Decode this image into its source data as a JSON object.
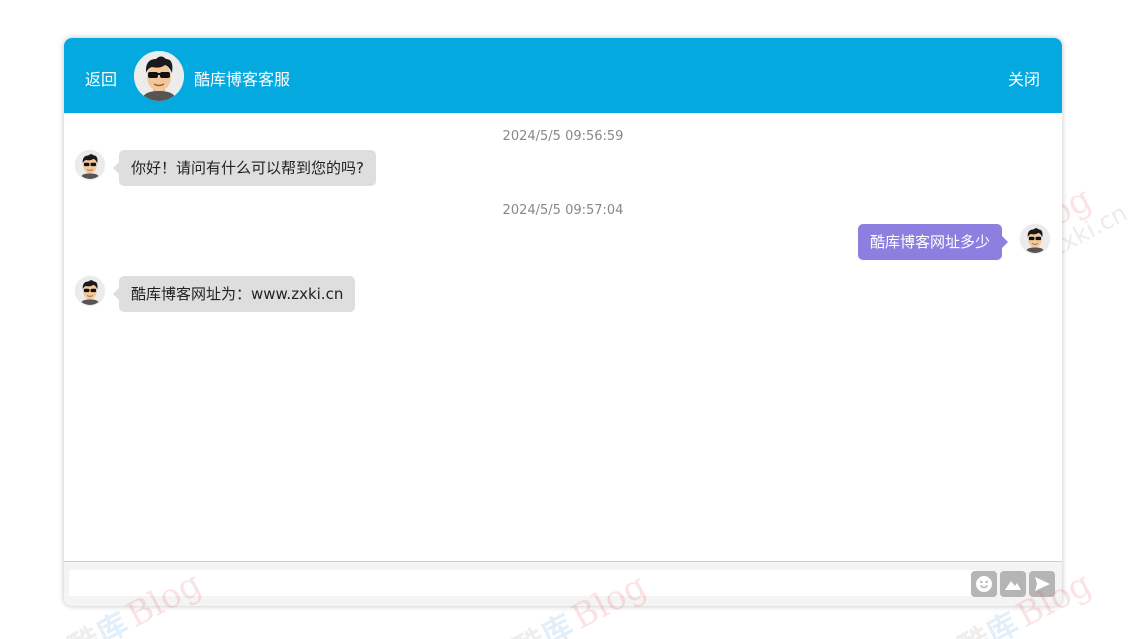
{
  "header": {
    "back_label": "返回",
    "title": "酷库博客客服",
    "close_label": "关闭",
    "background_color": "#03a9df"
  },
  "messages": [
    {
      "time": "2024/5/5 09:56:59",
      "direction": "incoming",
      "text": "你好！请问有什么可以帮到您的吗?"
    },
    {
      "time": "2024/5/5 09:57:04",
      "direction": "outgoing",
      "text": "酷库博客网址多少"
    },
    {
      "time": "",
      "direction": "incoming",
      "text": "酷库博客网址为：www.zxki.cn"
    }
  ],
  "composer": {
    "input_value": "",
    "tools": [
      "emoji-icon",
      "image-icon",
      "send-icon"
    ]
  },
  "watermark": {
    "cn_1": "酷",
    "cn_2": "库",
    "blog": "Blog",
    "url": "www.zxki.cn"
  },
  "colors": {
    "incoming_bubble": "#dedede",
    "outgoing_bubble": "#8c7fe0"
  }
}
